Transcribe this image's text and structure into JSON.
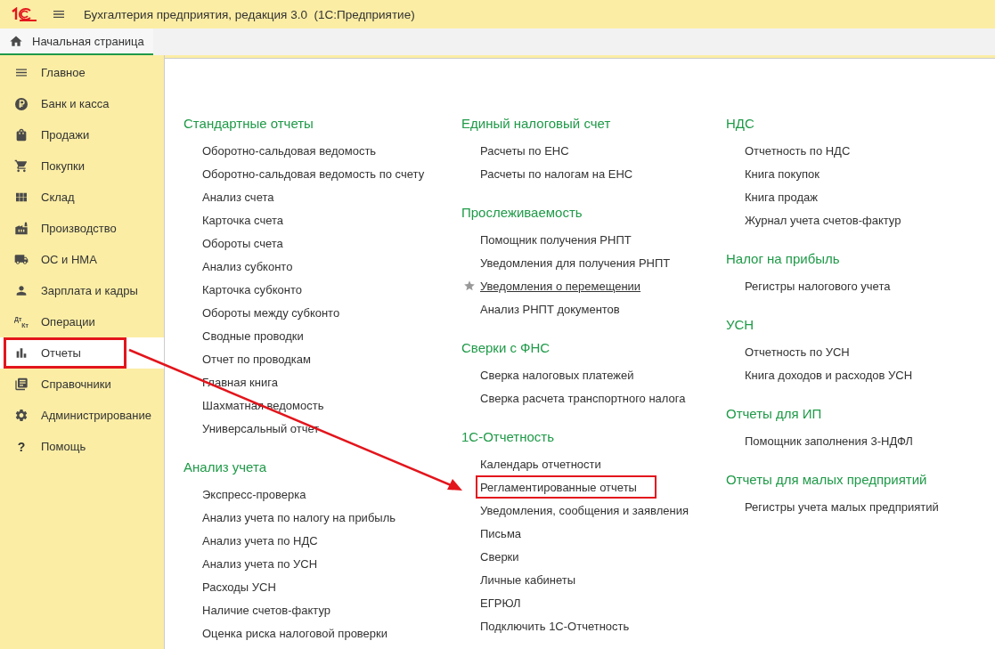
{
  "window": {
    "title": "Бухгалтерия предприятия, редакция 3.0  (1С:Предприятие)"
  },
  "tabs": [
    {
      "label": "Начальная страница",
      "selected": true
    }
  ],
  "sidebar": {
    "items": [
      {
        "label": "Главное",
        "selected": false,
        "highlighted": false
      },
      {
        "label": "Банк и касса",
        "selected": false,
        "highlighted": false
      },
      {
        "label": "Продажи",
        "selected": false,
        "highlighted": false
      },
      {
        "label": "Покупки",
        "selected": false,
        "highlighted": false
      },
      {
        "label": "Склад",
        "selected": false,
        "highlighted": false
      },
      {
        "label": "Производство",
        "selected": false,
        "highlighted": false
      },
      {
        "label": "ОС и НМА",
        "selected": false,
        "highlighted": false
      },
      {
        "label": "Зарплата и кадры",
        "selected": false,
        "highlighted": false
      },
      {
        "label": "Операции",
        "icon_label": [
          "Дт",
          "Кт"
        ],
        "selected": false,
        "highlighted": false
      },
      {
        "label": "Отчеты",
        "selected": true,
        "highlighted": true
      },
      {
        "label": "Справочники",
        "selected": false,
        "highlighted": false
      },
      {
        "label": "Администрирование",
        "selected": false,
        "highlighted": false
      },
      {
        "label": "Помощь",
        "icon_label": [
          "?"
        ],
        "selected": false,
        "highlighted": false
      }
    ]
  },
  "columns": [
    {
      "sections": [
        {
          "title": "Стандартные отчеты",
          "items": [
            {
              "label": "Оборотно-сальдовая ведомость"
            },
            {
              "label": "Оборотно-сальдовая ведомость по счету"
            },
            {
              "label": "Анализ счета"
            },
            {
              "label": "Карточка счета"
            },
            {
              "label": "Обороты счета"
            },
            {
              "label": "Анализ субконто"
            },
            {
              "label": "Карточка субконто"
            },
            {
              "label": "Обороты между субконто"
            },
            {
              "label": "Сводные проводки"
            },
            {
              "label": "Отчет по проводкам"
            },
            {
              "label": "Главная книга"
            },
            {
              "label": "Шахматная ведомость"
            },
            {
              "label": "Универсальный отчет"
            }
          ]
        },
        {
          "title": "Анализ учета",
          "items": [
            {
              "label": "Экспресс-проверка"
            },
            {
              "label": "Анализ учета по налогу на прибыль"
            },
            {
              "label": "Анализ учета по НДС"
            },
            {
              "label": "Анализ учета по УСН"
            },
            {
              "label": "Расходы УСН"
            },
            {
              "label": "Наличие счетов-фактур"
            },
            {
              "label": "Оценка риска налоговой проверки"
            }
          ]
        }
      ]
    },
    {
      "sections": [
        {
          "title": "Единый налоговый счет",
          "items": [
            {
              "label": "Расчеты по ЕНС"
            },
            {
              "label": "Расчеты по налогам на ЕНС"
            }
          ]
        },
        {
          "title": "Прослеживаемость",
          "items": [
            {
              "label": "Помощник получения РНПТ"
            },
            {
              "label": "Уведомления для получения РНПТ"
            },
            {
              "label": "Уведомления о перемещении",
              "favorite": true,
              "underlined": true
            },
            {
              "label": "Анализ РНПТ документов"
            }
          ]
        },
        {
          "title": "Сверки с ФНС",
          "items": [
            {
              "label": "Сверка налоговых платежей"
            },
            {
              "label": "Сверка расчета транспортного налога"
            }
          ]
        },
        {
          "title": "1С-Отчетность",
          "items": [
            {
              "label": "Календарь отчетности"
            },
            {
              "label": "Регламентированные отчеты",
              "highlighted": true
            },
            {
              "label": "Уведомления, сообщения и заявления"
            },
            {
              "label": "Письма"
            },
            {
              "label": "Сверки"
            },
            {
              "label": "Личные кабинеты"
            },
            {
              "label": "ЕГРЮЛ"
            },
            {
              "label": "Подключить 1С-Отчетность"
            }
          ]
        }
      ]
    },
    {
      "sections": [
        {
          "title": "НДС",
          "items": [
            {
              "label": "Отчетность по НДС"
            },
            {
              "label": "Книга покупок"
            },
            {
              "label": "Книга продаж"
            },
            {
              "label": "Журнал учета счетов-фактур"
            }
          ]
        },
        {
          "title": "Налог на прибыль",
          "items": [
            {
              "label": "Регистры налогового учета"
            }
          ]
        },
        {
          "title": "УСН",
          "items": [
            {
              "label": "Отчетность по УСН"
            },
            {
              "label": "Книга доходов и расходов УСН"
            }
          ]
        },
        {
          "title": "Отчеты для ИП",
          "items": [
            {
              "label": "Помощник заполнения 3-НДФЛ"
            }
          ]
        },
        {
          "title": "Отчеты для малых предприятий",
          "items": [
            {
              "label": "Регистры учета малых предприятий"
            }
          ]
        }
      ]
    }
  ]
}
